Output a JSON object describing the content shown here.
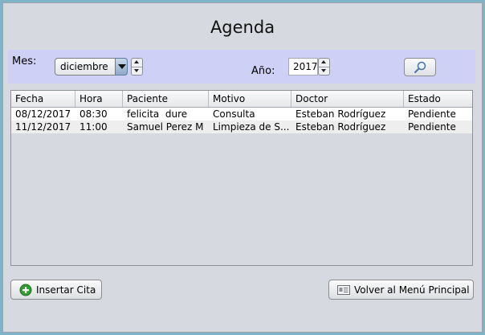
{
  "window": {
    "title": "Agenda"
  },
  "filters": {
    "month_label": "Mes:",
    "month_value": "diciembre",
    "year_label": "Año:",
    "year_value": "2017"
  },
  "table": {
    "columns": [
      "Fecha",
      "Hora",
      "Paciente",
      "Motivo",
      "Doctor",
      "Estado"
    ],
    "rows": [
      [
        "08/12/2017",
        "08:30",
        "felicita  dure",
        "Consulta",
        "Esteban Rodríguez",
        "Pendiente"
      ],
      [
        "11/12/2017",
        "11:00",
        "Samuel Perez M",
        "Limpieza de S...",
        "Esteban Rodríguez",
        "Pendiente"
      ]
    ]
  },
  "buttons": {
    "insert_label": "Insertar Cita",
    "back_label": "Volver al Menú Principal"
  },
  "icons": {
    "search": "magnifier-icon",
    "insert": "plus-circle-icon",
    "back": "id-card-icon"
  },
  "colors": {
    "filter_bar": "#cfd0f5",
    "insert_icon": "#2e9e2e"
  }
}
